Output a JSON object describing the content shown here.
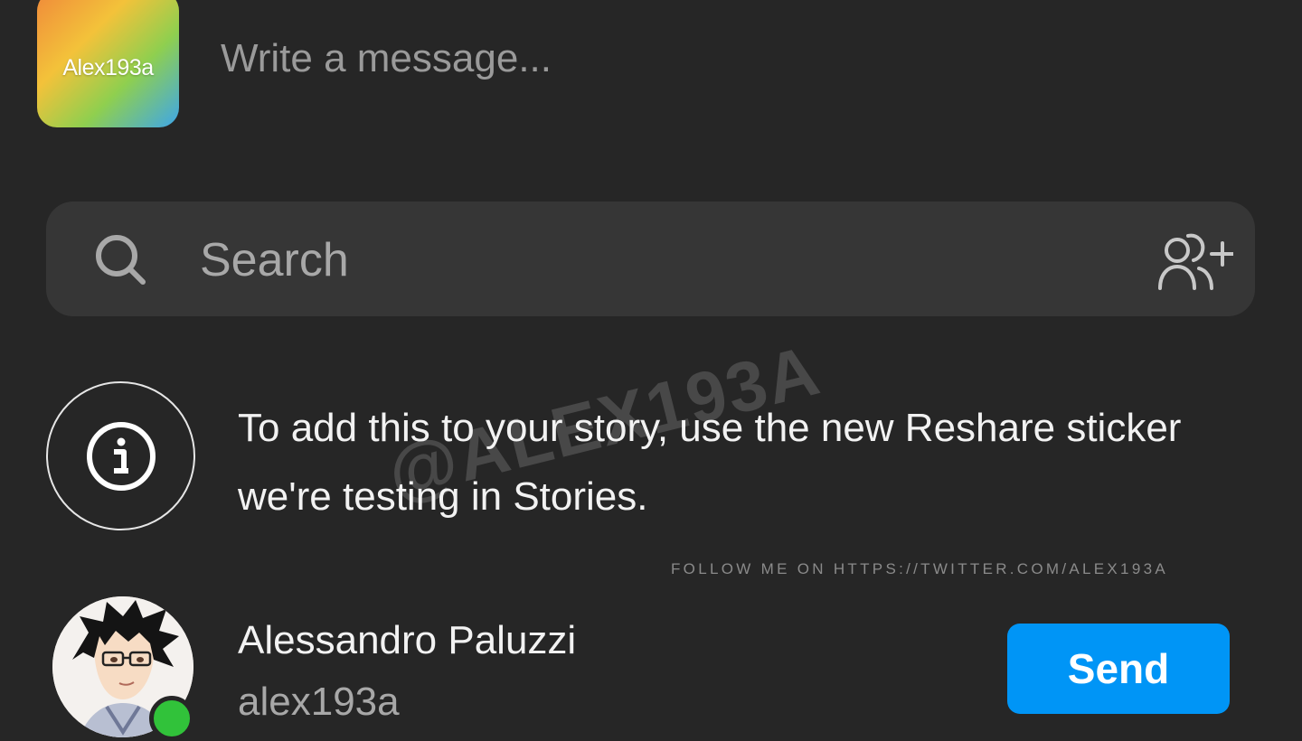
{
  "composer": {
    "thumbnail_label": "Alex193a",
    "message_placeholder": "Write a message..."
  },
  "search": {
    "placeholder": "Search"
  },
  "notice": {
    "text": "To add this to your story, use the new Reshare sticker we're testing in Stories."
  },
  "watermark": {
    "handle": "@ALEX193A",
    "follow_text": "FOLLOW ME ON HTTPS://TWITTER.COM/ALEX193A"
  },
  "contact": {
    "name": "Alessandro Paluzzi",
    "username": "alex193a",
    "online": true,
    "send_label": "Send"
  },
  "colors": {
    "background": "#262626",
    "search_bar": "#363636",
    "send_button": "#0095f6",
    "online_dot": "#31c23a"
  }
}
